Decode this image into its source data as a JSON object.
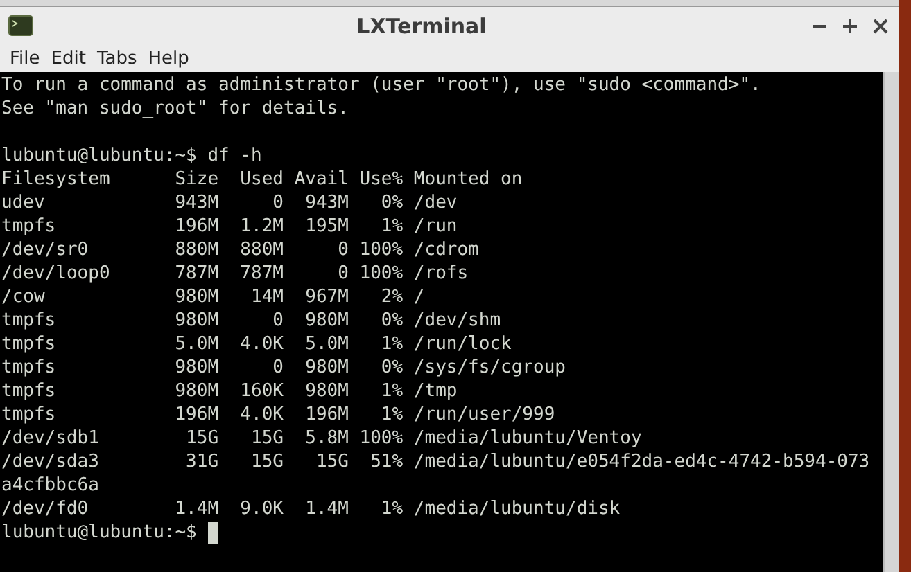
{
  "window": {
    "title": "LXTerminal"
  },
  "menu": [
    "File",
    "Edit",
    "Tabs",
    "Help"
  ],
  "terminal": {
    "banner": [
      "To run a command as administrator (user \"root\"), use \"sudo <command>\".",
      "See \"man sudo_root\" for details."
    ],
    "lines": [
      "lubuntu@lubuntu:~$ df -h",
      "Filesystem      Size  Used Avail Use% Mounted on",
      "udev            943M     0  943M   0% /dev",
      "tmpfs           196M  1.2M  195M   1% /run",
      "/dev/sr0        880M  880M     0 100% /cdrom",
      "/dev/loop0      787M  787M     0 100% /rofs",
      "/cow            980M   14M  967M   2% /",
      "tmpfs           980M     0  980M   0% /dev/shm",
      "tmpfs           5.0M  4.0K  5.0M   1% /run/lock",
      "tmpfs           980M     0  980M   0% /sys/fs/cgroup",
      "tmpfs           980M  160K  980M   1% /tmp",
      "tmpfs           196M  4.0K  196M   1% /run/user/999",
      "/dev/sdb1        15G   15G  5.8M 100% /media/lubuntu/Ventoy",
      "/dev/sda3        31G   15G   15G  51% /media/lubuntu/e054f2da-ed4c-4742-b594-073",
      "a4cfbbc6a",
      "/dev/fd0        1.4M  9.0K  1.4M   1% /media/lubuntu/disk",
      "lubuntu@lubuntu:~$ "
    ]
  }
}
